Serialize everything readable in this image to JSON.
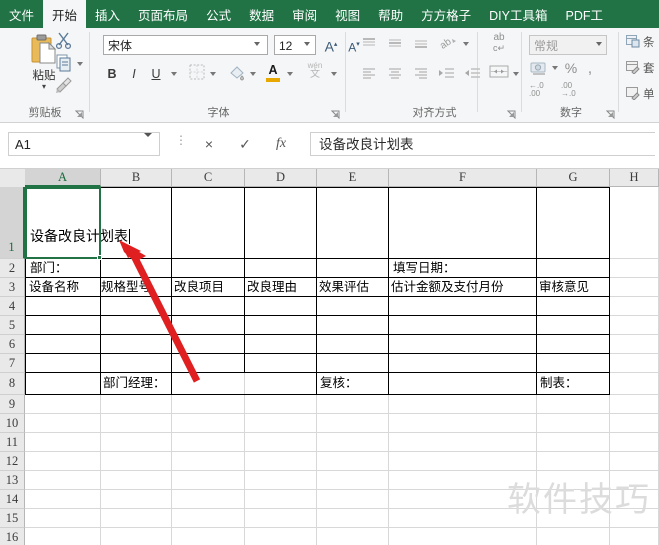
{
  "app": {
    "accent_green": "#217346",
    "ribbon_bg": "#f5f6f7"
  },
  "tabs": [
    {
      "label": "文件",
      "active": false
    },
    {
      "label": "开始",
      "active": true
    },
    {
      "label": "插入",
      "active": false
    },
    {
      "label": "页面布局",
      "active": false
    },
    {
      "label": "公式",
      "active": false
    },
    {
      "label": "数据",
      "active": false
    },
    {
      "label": "审阅",
      "active": false
    },
    {
      "label": "视图",
      "active": false
    },
    {
      "label": "帮助",
      "active": false
    },
    {
      "label": "方方格子",
      "active": false
    },
    {
      "label": "DIY工具箱",
      "active": false
    },
    {
      "label": "PDF工",
      "active": false
    }
  ],
  "ribbon": {
    "clipboard": {
      "group_label": "剪贴板",
      "paste_label": "粘贴",
      "paste_caret": "▾",
      "cut_icon": "scissors-icon",
      "copy_icon": "copy-icon",
      "format_painter_icon": "format-painter-icon"
    },
    "font": {
      "group_label": "字体",
      "font_name": "宋体",
      "font_size": "12",
      "grow_font": "A",
      "shrink_font": "A",
      "bold": "B",
      "italic": "I",
      "underline": "U",
      "borders_icon": "borders-icon",
      "fill_color_icon": "fill-color-icon",
      "font_color_letter": "A",
      "phonetic_top": "wén",
      "phonetic_bottom": "文"
    },
    "alignment": {
      "group_label": "对齐方式",
      "align_top_icon": "align-top-icon",
      "align_middle_icon": "align-middle-icon",
      "align_bottom_icon": "align-bottom-icon",
      "orientation_icon": "text-orientation-icon",
      "align_left_icon": "align-left-icon",
      "align_center_icon": "align-center-icon",
      "align_right_icon": "align-right-icon",
      "decrease_indent_icon": "decrease-indent-icon",
      "increase_indent_icon": "increase-indent-icon",
      "wrap_text_top": "ab",
      "wrap_text_bottom": "c↵",
      "merge_cells_icon": "merge-cells-icon"
    },
    "number": {
      "group_label": "数字",
      "format": "常规",
      "currency_icon": "currency-icon",
      "percent": "%",
      "comma": ",",
      "increase_decimal": ".00",
      "decrease_decimal": ".00"
    },
    "styles": [
      {
        "label": "条",
        "icon": "conditional-formatting-icon"
      },
      {
        "label": "套",
        "icon": "format-as-table-icon"
      },
      {
        "label": "单",
        "icon": "cell-styles-icon"
      }
    ]
  },
  "formula_bar": {
    "name_box": "A1",
    "cancel_icon": "×",
    "confirm_icon": "✓",
    "function_icon": "fx",
    "value": "设备改良计划表"
  },
  "grid": {
    "columns": [
      {
        "label": "A",
        "width": 76,
        "selected": true
      },
      {
        "label": "B",
        "width": 71,
        "selected": false
      },
      {
        "label": "C",
        "width": 73,
        "selected": false
      },
      {
        "label": "D",
        "width": 72,
        "selected": false
      },
      {
        "label": "E",
        "width": 72,
        "selected": false
      },
      {
        "label": "F",
        "width": 148,
        "selected": false
      },
      {
        "label": "G",
        "width": 73,
        "selected": false
      },
      {
        "label": "H",
        "width": 49,
        "selected": false
      }
    ],
    "rows": [
      {
        "label": "1",
        "height": 72,
        "selected": true
      },
      {
        "label": "2",
        "height": 19,
        "selected": false
      },
      {
        "label": "3",
        "height": 19,
        "selected": false
      },
      {
        "label": "4",
        "height": 19,
        "selected": false
      },
      {
        "label": "5",
        "height": 19,
        "selected": false
      },
      {
        "label": "6",
        "height": 19,
        "selected": false
      },
      {
        "label": "7",
        "height": 19,
        "selected": false
      },
      {
        "label": "8",
        "height": 22,
        "selected": false
      },
      {
        "label": "9",
        "height": 19,
        "selected": false
      },
      {
        "label": "10",
        "height": 19,
        "selected": false
      },
      {
        "label": "11",
        "height": 19,
        "selected": false
      },
      {
        "label": "12",
        "height": 19,
        "selected": false
      },
      {
        "label": "13",
        "height": 19,
        "selected": false
      },
      {
        "label": "14",
        "height": 19,
        "selected": false
      },
      {
        "label": "15",
        "height": 19,
        "selected": false
      },
      {
        "label": "16",
        "height": 19,
        "selected": false
      }
    ],
    "active_cell": "A1",
    "editing": true,
    "cells": [
      {
        "ref": "A1",
        "text": "设备改良计划表",
        "col": 0,
        "row": 0,
        "editing": true
      },
      {
        "ref": "A2",
        "text": "部门：",
        "col": 0,
        "row": 1,
        "editing": false
      },
      {
        "ref": "F2",
        "text": "填写日期：",
        "col": 5,
        "row": 1,
        "editing": false
      },
      {
        "ref": "A3",
        "text": "设备名称",
        "col": 0,
        "row": 2,
        "editing": false
      },
      {
        "ref": "B3",
        "text": "规格型号",
        "col": 1,
        "row": 2,
        "editing": false
      },
      {
        "ref": "C3",
        "text": "改良项目",
        "col": 2,
        "row": 2,
        "editing": false
      },
      {
        "ref": "D3",
        "text": "改良理由",
        "col": 3,
        "row": 2,
        "editing": false
      },
      {
        "ref": "E3",
        "text": "效果评估",
        "col": 4,
        "row": 2,
        "editing": false
      },
      {
        "ref": "F3",
        "text": "估计金额及支付月份",
        "col": 5,
        "row": 2,
        "editing": false
      },
      {
        "ref": "G3",
        "text": "审核意见",
        "col": 6,
        "row": 2,
        "editing": false
      },
      {
        "ref": "B8",
        "text": "部门经理：",
        "col": 1,
        "row": 7,
        "editing": false
      },
      {
        "ref": "E8",
        "text": "复核：",
        "col": 4,
        "row": 7,
        "editing": false
      },
      {
        "ref": "G8",
        "text": "制表：",
        "col": 6,
        "row": 7,
        "editing": false
      }
    ]
  },
  "annotation": {
    "arrow_color": "#e02020",
    "arrow_name": "red-arrow-pointing-to-a1"
  },
  "watermark": {
    "text": "软件技巧",
    "color": "#dcdcdc"
  }
}
